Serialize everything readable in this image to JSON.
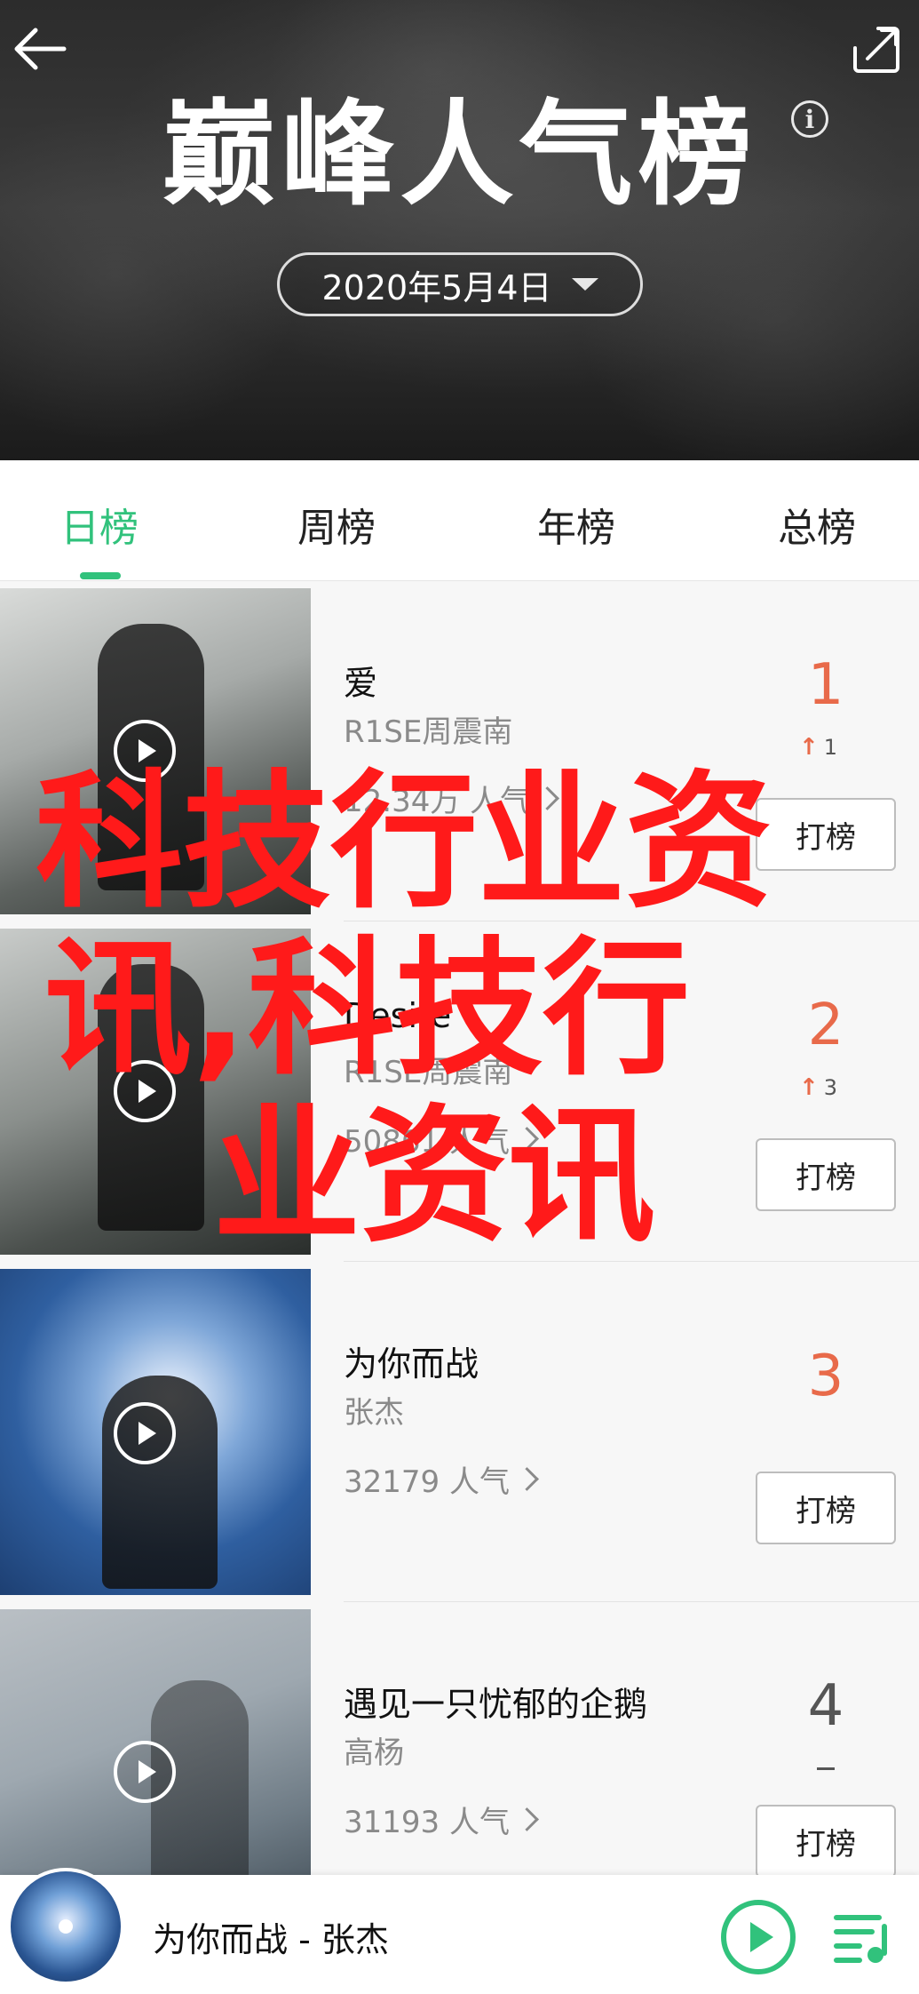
{
  "header": {
    "title": "巅峰人气榜",
    "date": "2020年5月4日"
  },
  "icons": {
    "back": "back-arrow-icon",
    "share": "share-icon",
    "info": "info-icon",
    "dropdown": "chevron-down-icon"
  },
  "tabs": [
    {
      "label": "日榜",
      "active": true
    },
    {
      "label": "周榜",
      "active": false
    },
    {
      "label": "年榜",
      "active": false
    },
    {
      "label": "总榜",
      "active": false
    }
  ],
  "songs": [
    {
      "title": "爱",
      "artist": "R1SE周震南",
      "popularity": "12.34万 人气",
      "rank": "1",
      "trend": "1",
      "action": "打榜"
    },
    {
      "title": "Desire",
      "artist": "R1SE周震南",
      "popularity": "50861 人气",
      "rank": "2",
      "trend": "3",
      "action": "打榜"
    },
    {
      "title": "为你而战",
      "artist": "张杰",
      "popularity": "32179 人气",
      "rank": "3",
      "trend": "",
      "action": "打榜"
    },
    {
      "title": "遇见一只忧郁的企鹅",
      "artist": "高杨",
      "popularity": "31193 人气",
      "rank": "4",
      "trend": "—",
      "action": "打榜"
    }
  ],
  "watermark": {
    "line1": "科技行业资",
    "line2": "讯,科技行",
    "line3": "业资讯"
  },
  "player": {
    "now_playing": "为你而战 - 张杰"
  },
  "colors": {
    "accent": "#31c27c",
    "rank_up": "#e86a4a",
    "watermark": "#ff1a1a"
  }
}
